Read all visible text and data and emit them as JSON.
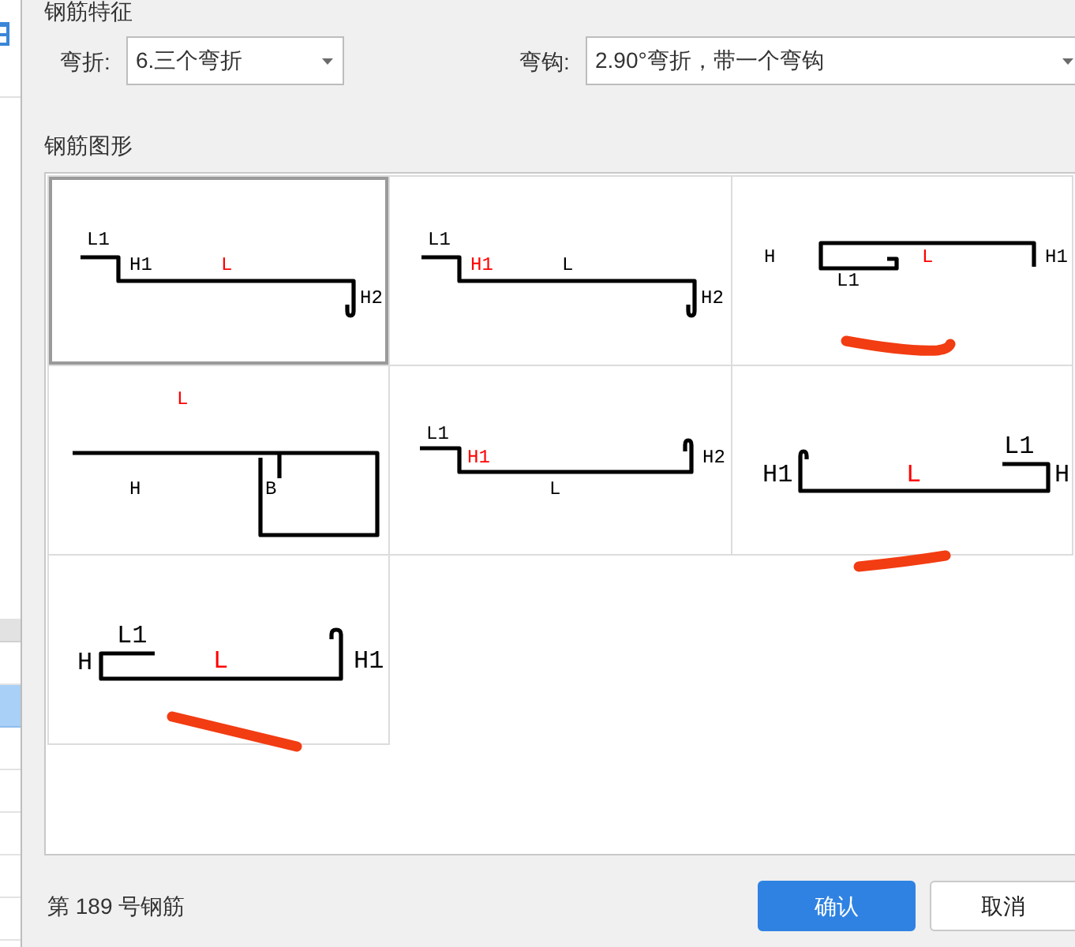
{
  "background_window": {
    "rows": [
      {
        "selected": false
      },
      {
        "selected": true
      },
      {
        "selected": false
      },
      {
        "selected": false
      },
      {
        "selected": false
      },
      {
        "selected": false
      },
      {
        "selected": false
      }
    ]
  },
  "section_title": "钢筋特征",
  "fields": [
    {
      "label": "弯折:",
      "value": "6.三个弯折"
    },
    {
      "label": "弯钩:",
      "value": "2.90°弯折，带一个弯钩"
    }
  ],
  "shapes_title": "钢筋图形",
  "shapes": [
    {
      "kind": "dropcrank",
      "selected": true,
      "annotated": false,
      "labels": [
        {
          "text": "L1",
          "highlighted": false
        },
        {
          "text": "H1",
          "highlighted": false
        },
        {
          "text": "L",
          "highlighted": true
        },
        {
          "text": "H2",
          "highlighted": false
        }
      ]
    },
    {
      "kind": "dropcrank",
      "selected": false,
      "annotated": false,
      "labels": [
        {
          "text": "L1",
          "highlighted": false
        },
        {
          "text": "H1",
          "highlighted": true
        },
        {
          "text": "L",
          "highlighted": false
        },
        {
          "text": "H2",
          "highlighted": false
        }
      ]
    },
    {
      "kind": "closedloop",
      "selected": false,
      "annotated": true,
      "labels": [
        {
          "text": "H",
          "highlighted": false
        },
        {
          "text": "L",
          "highlighted": true
        },
        {
          "text": "H1",
          "highlighted": false
        },
        {
          "text": "L1",
          "highlighted": false
        }
      ]
    },
    {
      "kind": "boxhook",
      "selected": false,
      "annotated": false,
      "labels": [
        {
          "text": "L",
          "highlighted": true
        },
        {
          "text": "H",
          "highlighted": false
        },
        {
          "text": "B",
          "highlighted": false
        }
      ]
    },
    {
      "kind": "raisecrank",
      "selected": false,
      "annotated": false,
      "labels": [
        {
          "text": "L1",
          "highlighted": false
        },
        {
          "text": "H1",
          "highlighted": true
        },
        {
          "text": "H2",
          "highlighted": false
        },
        {
          "text": "L",
          "highlighted": false
        }
      ]
    },
    {
      "kind": "channel",
      "selected": false,
      "annotated": true,
      "labels": [
        {
          "text": "L1",
          "highlighted": false
        },
        {
          "text": "H1",
          "highlighted": false
        },
        {
          "text": "L",
          "highlighted": true
        },
        {
          "text": "H",
          "highlighted": false
        }
      ]
    },
    {
      "kind": "tray",
      "selected": false,
      "annotated": true,
      "labels": [
        {
          "text": "L1",
          "highlighted": false
        },
        {
          "text": "H",
          "highlighted": false
        },
        {
          "text": "L",
          "highlighted": true
        },
        {
          "text": "H1",
          "highlighted": false
        }
      ]
    }
  ],
  "footer": {
    "status": "第 189 号钢筋",
    "buttons": [
      {
        "label": "确认",
        "kind": "primary"
      },
      {
        "label": "取消",
        "kind": "secondary"
      }
    ]
  }
}
